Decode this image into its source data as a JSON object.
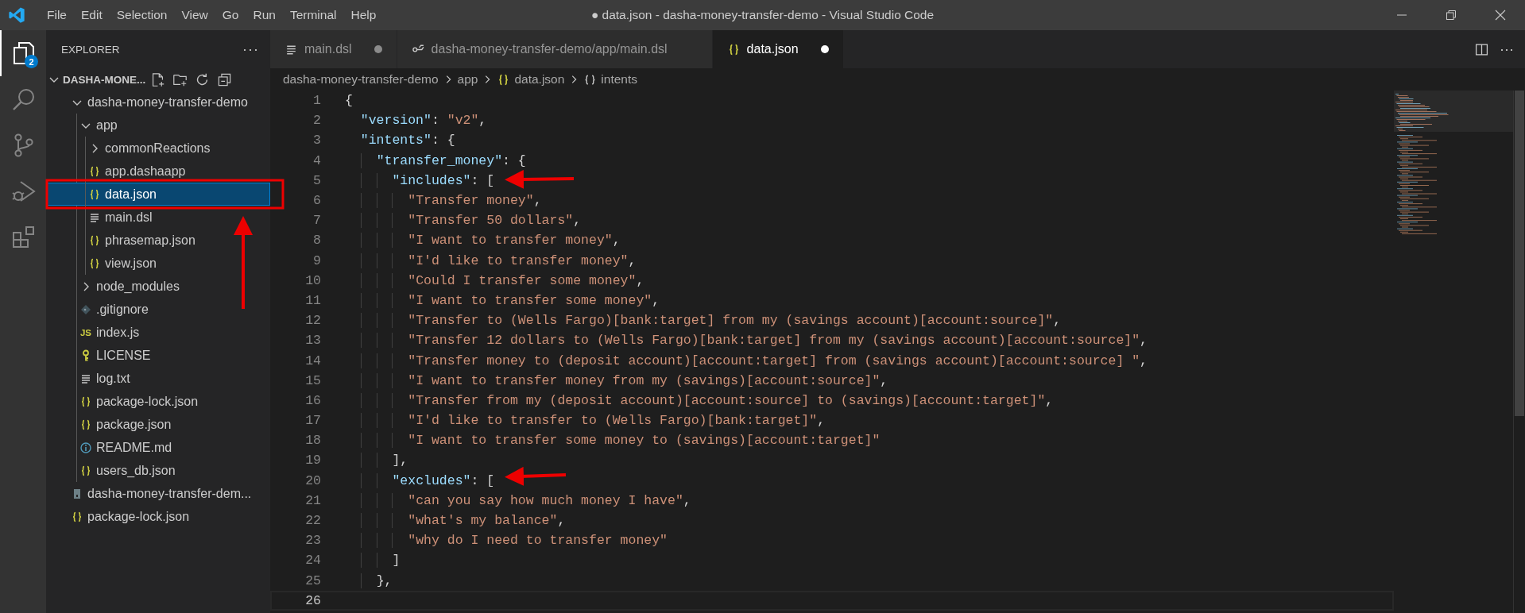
{
  "window": {
    "title": "● data.json - dasha-money-transfer-demo - Visual Studio Code"
  },
  "menu": [
    "File",
    "Edit",
    "Selection",
    "View",
    "Go",
    "Run",
    "Terminal",
    "Help"
  ],
  "activity_bar": [
    {
      "kind": "explorer",
      "selected": true,
      "badge": "2"
    },
    {
      "kind": "search",
      "selected": false
    },
    {
      "kind": "source-control",
      "selected": false
    },
    {
      "kind": "run-debug",
      "selected": false
    },
    {
      "kind": "extensions",
      "selected": false
    }
  ],
  "explorer": {
    "title": "EXPLORER",
    "more": "···",
    "section": {
      "title": "DASHA-MONE...",
      "expanded": true
    },
    "tree": [
      {
        "label": "dasha-money-transfer-demo",
        "kind": "folder",
        "expanded": true,
        "selected": false,
        "children": [
          {
            "label": "app",
            "kind": "folder",
            "expanded": true,
            "selected": false,
            "children": [
              {
                "label": "commonReactions",
                "kind": "folder",
                "expanded": false,
                "selected": false
              },
              {
                "label": "app.dashaapp",
                "kind": "json",
                "selected": false
              },
              {
                "label": "data.json",
                "kind": "json",
                "selected": true
              },
              {
                "label": "main.dsl",
                "kind": "lines",
                "selected": false
              },
              {
                "label": "phrasemap.json",
                "kind": "json",
                "selected": false
              },
              {
                "label": "view.json",
                "kind": "json",
                "selected": false
              }
            ]
          },
          {
            "label": "node_modules",
            "kind": "folder",
            "expanded": false,
            "selected": false
          },
          {
            "label": ".gitignore",
            "kind": "git",
            "selected": false
          },
          {
            "label": "index.js",
            "kind": "js",
            "badge": "JS",
            "selected": false
          },
          {
            "label": "LICENSE",
            "kind": "key",
            "selected": false
          },
          {
            "label": "log.txt",
            "kind": "lines",
            "selected": false
          },
          {
            "label": "package-lock.json",
            "kind": "json",
            "selected": false
          },
          {
            "label": "package.json",
            "kind": "json",
            "selected": false
          },
          {
            "label": "README.md",
            "kind": "info",
            "selected": false
          },
          {
            "label": "users_db.json",
            "kind": "json",
            "selected": false
          }
        ]
      },
      {
        "label": "dasha-money-transfer-dem...",
        "kind": "file",
        "selected": false
      },
      {
        "label": "package-lock.json",
        "kind": "json",
        "selected": false
      }
    ]
  },
  "tabs": [
    {
      "label": "main.dsl",
      "kind": "lines",
      "dirty": true,
      "selected": false
    },
    {
      "label": "dasha-money-transfer-demo/app/main.dsl",
      "kind": "compare",
      "dirty": false,
      "selected": false
    },
    {
      "label": "data.json",
      "kind": "json",
      "dirty": true,
      "selected": true
    }
  ],
  "editor_actions": {
    "more": "···"
  },
  "breadcrumbs": [
    {
      "label": "dasha-money-transfer-demo",
      "kind": "folder"
    },
    {
      "label": "app",
      "kind": "folder"
    },
    {
      "label": "data.json",
      "kind": "json"
    },
    {
      "label": "intents",
      "kind": "object"
    }
  ],
  "lines": [
    {
      "number": "1",
      "text": "{",
      "current": false
    },
    {
      "number": "2",
      "text": "  \"version\": \"v2\",",
      "current": false
    },
    {
      "number": "3",
      "text": "  \"intents\": {",
      "current": false
    },
    {
      "number": "4",
      "text": "    \"transfer_money\": {",
      "current": false
    },
    {
      "number": "5",
      "text": "      \"includes\": [",
      "current": false
    },
    {
      "number": "6",
      "text": "        \"Transfer money\",",
      "current": false
    },
    {
      "number": "7",
      "text": "        \"Transfer 50 dollars\",",
      "current": false
    },
    {
      "number": "8",
      "text": "        \"I want to transfer money\",",
      "current": false
    },
    {
      "number": "9",
      "text": "        \"I'd like to transfer money\",",
      "current": false
    },
    {
      "number": "10",
      "text": "        \"Could I transfer some money\",",
      "current": false
    },
    {
      "number": "11",
      "text": "        \"I want to transfer some money\",",
      "current": false
    },
    {
      "number": "12",
      "text": "        \"Transfer to (Wells Fargo)[bank:target] from my (savings account)[account:source]\",",
      "current": false
    },
    {
      "number": "13",
      "text": "        \"Transfer 12 dollars to (Wells Fargo)[bank:target] from my (savings account)[account:source]\",",
      "current": false
    },
    {
      "number": "14",
      "text": "        \"Transfer money to (deposit account)[account:target] from (savings account)[account:source] \",",
      "current": false
    },
    {
      "number": "15",
      "text": "        \"I want to transfer money from my (savings)[account:source]\",",
      "current": false
    },
    {
      "number": "16",
      "text": "        \"Transfer from my (deposit account)[account:source] to (savings)[account:target]\",",
      "current": false
    },
    {
      "number": "17",
      "text": "        \"I'd like to transfer to (Wells Fargo)[bank:target]\",",
      "current": false
    },
    {
      "number": "18",
      "text": "        \"I want to transfer some money to (savings)[account:target]\"",
      "current": false
    },
    {
      "number": "19",
      "text": "      ],",
      "current": false
    },
    {
      "number": "20",
      "text": "      \"excludes\": [",
      "current": false
    },
    {
      "number": "21",
      "text": "        \"can you say how much money I have\",",
      "current": false
    },
    {
      "number": "22",
      "text": "        \"what's my balance\",",
      "current": false
    },
    {
      "number": "23",
      "text": "        \"why do I need to transfer money\"",
      "current": false
    },
    {
      "number": "24",
      "text": "      ]",
      "current": false
    },
    {
      "number": "25",
      "text": "    },",
      "current": false
    },
    {
      "number": "26",
      "current": true
    }
  ]
}
